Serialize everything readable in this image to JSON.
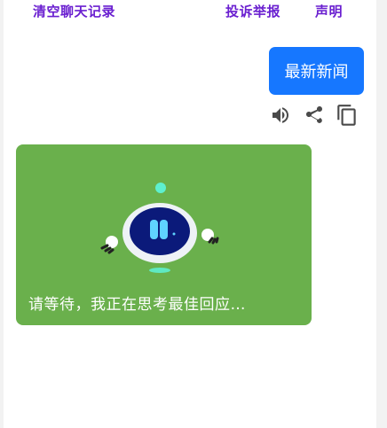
{
  "header": {
    "clear_label": "清空聊天记录",
    "report_label": "投诉举报",
    "statement_label": "声明"
  },
  "chat": {
    "user_message": "最新新闻",
    "bot_message": "请等待，我正在思考最佳回应…"
  },
  "actions": {
    "icons": [
      "speaker-icon",
      "share-icon",
      "copy-icon"
    ]
  },
  "colors": {
    "link": "#6a1fd0",
    "user_bubble": "#1677ff",
    "bot_card": "#6ab04c"
  }
}
